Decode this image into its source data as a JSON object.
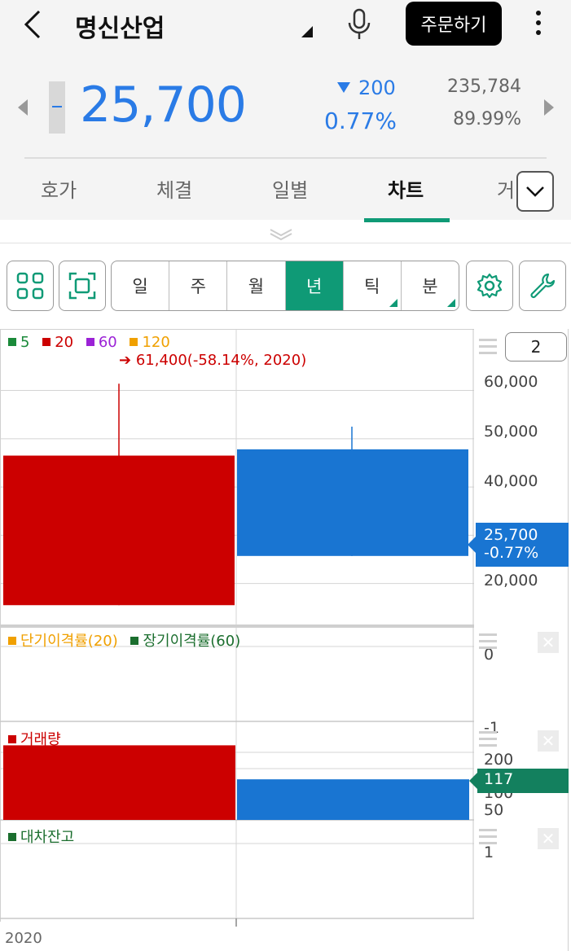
{
  "header": {
    "title": "명신산업",
    "order_button": "주문하기",
    "price": "25,700",
    "change": "200",
    "change_pct": "0.77%",
    "volume": "235,784",
    "ratio": "89.99%"
  },
  "tabs": [
    "호가",
    "체결",
    "일별",
    "차트",
    "거"
  ],
  "active_tab": "차트",
  "toolbar": {
    "periods": [
      "일",
      "주",
      "월",
      "년",
      "틱",
      "분"
    ],
    "active_period": "년"
  },
  "chart": {
    "candle_count_input": "2",
    "price_tag": {
      "price": "25,700",
      "pct": "-0.77%"
    },
    "volume_tag": "117",
    "colors": {
      "up": "#cc0000",
      "down": "#1975d2",
      "accent": "#0f9a76"
    }
  },
  "chart_data": [
    {
      "type": "candlestick",
      "legend": [
        {
          "name": "5",
          "color": "#1b8a3a"
        },
        {
          "name": "20",
          "color": "#cc0000"
        },
        {
          "name": "60",
          "color": "#9b22d6"
        },
        {
          "name": "120",
          "color": "#f0a000"
        }
      ],
      "annotation": "61,400(-58.14%, 2020)",
      "y_ticks": [
        "60,000",
        "50,000",
        "40,000",
        "20,000"
      ],
      "ylim": [
        12000,
        66000
      ],
      "x_label": "2020",
      "candles": [
        {
          "open": 15500,
          "high": 61400,
          "low": 15500,
          "close": 46500,
          "direction": "up"
        },
        {
          "open": 47800,
          "high": 52500,
          "low": 25700,
          "close": 25700,
          "direction": "down"
        }
      ]
    },
    {
      "type": "line",
      "legend": [
        {
          "name": "단기이격률(20)",
          "color": "#f0a000"
        },
        {
          "name": "장기이격률(60)",
          "color": "#1b6e2e"
        }
      ],
      "y_ticks": [
        "0",
        "-1"
      ]
    },
    {
      "type": "bar",
      "legend": [
        {
          "name": "거래량",
          "color": "#cc0000"
        }
      ],
      "y_ticks": [
        "200",
        "100",
        "50"
      ],
      "ylim": [
        0,
        230
      ],
      "values": [
        215,
        117
      ],
      "colors": [
        "#cc0000",
        "#1975d2"
      ]
    },
    {
      "type": "line",
      "legend": [
        {
          "name": "대차잔고",
          "color": "#1b6e2e"
        }
      ],
      "y_ticks": [
        "1"
      ]
    }
  ]
}
